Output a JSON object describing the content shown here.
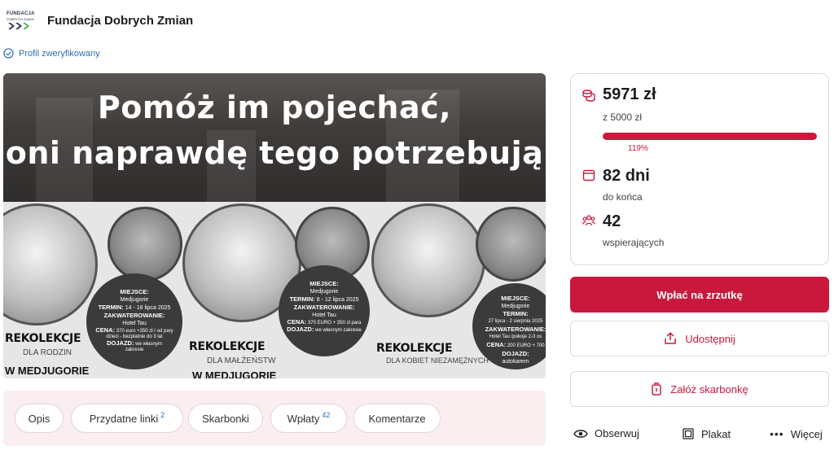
{
  "org": {
    "logo_top": "FUNDACJA",
    "logo_bottom": "DOBRYCH ZMIAN",
    "name": "Fundacja Dobrych Zmian"
  },
  "verified": {
    "label": "Profil zweryfikowany"
  },
  "hero": {
    "title_line1": "Pomóż im pojechać,",
    "title_line2": "oni naprawdę tego potrzebują",
    "panels": [
      {
        "place_label": "MIEJSCE:",
        "place": "Medjugorie",
        "term_label": "TERMIN:",
        "term": "14 - 18 lipca 2025",
        "stay_label": "ZAKWATEROWANIE:",
        "stay": "Hotel Tau",
        "price_label": "CENA:",
        "price": "370 euro +350 zł / od pary dzieci - bezpłatnie do 3 lat",
        "travel_label": "DOJAZD:",
        "travel": "we własnym zakresie",
        "retreat": "REKOLEKCJE",
        "for": "DLA RODZIN",
        "where": "W MEDJUGORIE"
      },
      {
        "place_label": "MIEJSCE:",
        "place": "Medjugorie",
        "term_label": "TERMIN:",
        "term": "8 - 12 lipca 2025",
        "stay_label": "ZAKWATEROWANIE:",
        "stay": "Hotel Tau",
        "price_label": "CENA:",
        "price": "370 EURO + 350 zł para",
        "travel_label": "DOJAZD:",
        "travel": "we własnym zakresie",
        "retreat": "REKOLEKCJE",
        "for": "DLA MAŁŻEŃSTW",
        "where": "W MEDJUGORIE"
      },
      {
        "place_label": "MIEJSCE:",
        "place": "Medjugorie",
        "term_label": "TERMIN:",
        "term": "27 lipca - 2 sierpnia 2025",
        "stay_label": "ZAKWATEROWANIE:",
        "stay": "Hotel Tau /pokoje 2-3 os",
        "price_label": "CENA:",
        "price": "200 EURO + 700",
        "travel_label": "DOJAZD:",
        "travel": "autokarem",
        "retreat": "REKOLEKCJE",
        "for": "DLA KOBIET NIEZAMĘŻNYCH",
        "where": ""
      }
    ]
  },
  "tabs": [
    {
      "label": "Opis",
      "count": ""
    },
    {
      "label": "Przydatne linki",
      "count": "2"
    },
    {
      "label": "Skarbonki",
      "count": ""
    },
    {
      "label": "Wpłaty",
      "count": "42"
    },
    {
      "label": "Komentarze",
      "count": ""
    }
  ],
  "stats": {
    "raised": "5971 zł",
    "goal": "z 5000 zł",
    "percent_label": "119%",
    "progress": 1.0,
    "days": "82 dni",
    "days_label": "do końca",
    "supporters": "42",
    "supporters_label": "wspierających",
    "accent": "#c8193c"
  },
  "buttons": {
    "donate": "Wpłać na zrzutkę",
    "share": "Udostępnij",
    "piggy": "Załóż skarbonkę"
  },
  "actions": {
    "follow": "Obserwuj",
    "poster": "Plakat",
    "more": "Więcej"
  }
}
